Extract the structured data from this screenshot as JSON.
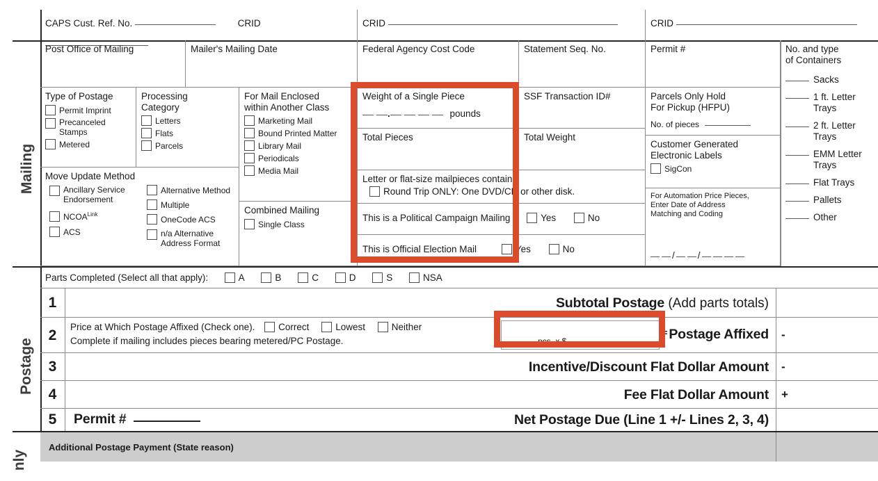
{
  "form": {
    "section_labels": {
      "mailing": "Mailing",
      "postage": "Postage",
      "usps_only": "nly"
    },
    "header": {
      "caps_ref_label": "CAPS Cust. Ref. No.",
      "crid_label_1": "CRID",
      "crid_label_2": "CRID",
      "crid_label_3": "CRID"
    },
    "row2": {
      "post_office": "Post Office of Mailing",
      "mailing_date": "Mailer's Mailing Date",
      "federal_agency_cost_code": "Federal Agency Cost Code",
      "statement_seq_no": "Statement Seq. No.",
      "permit_no": "Permit #",
      "containers_title_line1": "No. and type",
      "containers_title_line2": "of Containers"
    },
    "type_of_postage": {
      "title": "Type of Postage",
      "options": [
        "Permit Imprint",
        "Precanceled Stamps",
        "Metered"
      ]
    },
    "processing_category": {
      "title_line1": "Processing",
      "title_line2": "Category",
      "options": [
        "Letters",
        "Flats",
        "Parcels"
      ]
    },
    "mail_enclosed": {
      "title_line1": "For Mail Enclosed",
      "title_line2": "within Another Class",
      "options": [
        "Marketing Mail",
        "Bound Printed Matter",
        "Library Mail",
        "Periodicals",
        "Media Mail"
      ]
    },
    "move_update": {
      "title": "Move Update Method",
      "left_options": [
        "Ancillary Service Endorsement",
        "NCOA",
        "ACS"
      ],
      "ncoa_superscript": "Link",
      "right_options": [
        "Alternative Method",
        "Multiple",
        "OneCode ACS",
        "n/a Alternative Address Format"
      ]
    },
    "combined_mailing": {
      "title": "Combined Mailing",
      "options": [
        "Single Class"
      ]
    },
    "weight": {
      "single_piece_label": "Weight of a Single Piece",
      "pounds_unit": "pounds",
      "total_pieces_label": "Total Pieces",
      "total_weight_label": "Total Weight",
      "ssf_transaction_label": "SSF Transaction ID#"
    },
    "letter_flat": {
      "prompt": "Letter or flat-size mailpieces contain:",
      "option": "Round Trip ONLY: One DVD/CD or other disk."
    },
    "political": {
      "label": "This is a Political Campaign Mailing",
      "yes": "Yes",
      "no": "No"
    },
    "election": {
      "label": "This is Official Election Mail",
      "yes": "Yes",
      "no": "No"
    },
    "hfpu": {
      "title_line1": "Parcels Only Hold",
      "title_line2": "For Pickup (HFPU)",
      "pieces_label": "No. of pieces"
    },
    "electronic_labels": {
      "title_line1": "Customer Generated",
      "title_line2": "Electronic Labels",
      "option": "SigCon"
    },
    "automation": {
      "line1": "For Automation Price Pieces,",
      "line2": "Enter Date of Address",
      "line3": "Matching and Coding"
    },
    "containers": [
      {
        "label": "Sacks"
      },
      {
        "label": "1 ft. Letter Trays"
      },
      {
        "label": "2 ft. Letter Trays"
      },
      {
        "label": "EMM Letter Trays"
      },
      {
        "label": "Flat Trays"
      },
      {
        "label": "Pallets"
      },
      {
        "label": "Other"
      }
    ],
    "parts_completed": {
      "label": "Parts Completed (Select all that apply):",
      "options": [
        "A",
        "B",
        "C",
        "D",
        "S",
        "NSA"
      ]
    },
    "postage_lines": [
      {
        "number": "1",
        "title_bold": "Subtotal Postage",
        "title_rest": " (Add parts totals)",
        "operator": ""
      },
      {
        "number": "2",
        "title_bold": "Postage Affixed",
        "title_rest": "",
        "operator": "-",
        "left_line1": "Price at Which Postage Affixed (Check one).",
        "left_line2": "Complete if mailing includes pieces bearing metered/PC Postage.",
        "check_options": [
          "Correct",
          "Lowest",
          "Neither"
        ],
        "calc_pcs": "pcs. x $",
        "calc_equals": "="
      },
      {
        "number": "3",
        "title_bold": "Incentive/Discount Flat Dollar Amount",
        "title_rest": "",
        "operator": "-"
      },
      {
        "number": "4",
        "title_bold": "Fee Flat Dollar Amount",
        "title_rest": "",
        "operator": "+"
      },
      {
        "number": "5",
        "title_bold": "Net Postage Due (Line 1 +/- Lines 2, 3, 4)",
        "title_rest": "",
        "operator": "",
        "permit_label": "Permit #"
      }
    ],
    "additional_payment": {
      "label": "Additional Postage Payment (State reason)"
    },
    "annotations": {
      "highlight_color": "#DC4A2C",
      "boxes": [
        {
          "name": "weight-total-pieces-highlight"
        },
        {
          "name": "postage-affixed-calc-highlight"
        }
      ]
    }
  }
}
